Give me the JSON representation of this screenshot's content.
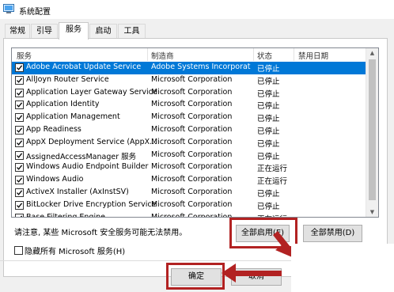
{
  "window": {
    "title": "系统配置"
  },
  "tabs": [
    {
      "label": "常规",
      "active": false
    },
    {
      "label": "引导",
      "active": false
    },
    {
      "label": "服务",
      "active": true
    },
    {
      "label": "启动",
      "active": false
    },
    {
      "label": "工具",
      "active": false
    }
  ],
  "table": {
    "headers": {
      "service": "服务",
      "manufacturer": "制造商",
      "status": "状态",
      "disabled_date": "禁用日期"
    },
    "rows": [
      {
        "name": "Adobe Acrobat Update Service",
        "manufacturer": "Adobe Systems Incorporat",
        "status": "已停止",
        "checked": true,
        "selected": true
      },
      {
        "name": "AllJoyn Router Service",
        "manufacturer": "Microsoft Corporation",
        "status": "已停止",
        "checked": true
      },
      {
        "name": "Application Layer Gateway Service",
        "manufacturer": "Microsoft Corporation",
        "status": "已停止",
        "checked": true
      },
      {
        "name": "Application Identity",
        "manufacturer": "Microsoft Corporation",
        "status": "已停止",
        "checked": true
      },
      {
        "name": "Application Management",
        "manufacturer": "Microsoft Corporation",
        "status": "已停止",
        "checked": true
      },
      {
        "name": "App Readiness",
        "manufacturer": "Microsoft Corporation",
        "status": "已停止",
        "checked": true
      },
      {
        "name": "AppX Deployment Service (AppX...",
        "manufacturer": "Microsoft Corporation",
        "status": "已停止",
        "checked": true
      },
      {
        "name": "AssignedAccessManager 服务",
        "manufacturer": "Microsoft Corporation",
        "status": "已停止",
        "checked": true
      },
      {
        "name": "Windows Audio Endpoint Builder",
        "manufacturer": "Microsoft Corporation",
        "status": "正在运行",
        "checked": true
      },
      {
        "name": "Windows Audio",
        "manufacturer": "Microsoft Corporation",
        "status": "正在运行",
        "checked": true
      },
      {
        "name": "ActiveX Installer (AxInstSV)",
        "manufacturer": "Microsoft Corporation",
        "status": "已停止",
        "checked": true
      },
      {
        "name": "BitLocker Drive Encryption Service",
        "manufacturer": "Microsoft Corporation",
        "status": "已停止",
        "checked": true
      },
      {
        "name": "Base Filtering Engine",
        "manufacturer": "Microsoft Corporation",
        "status": "正在运行",
        "checked": true
      }
    ]
  },
  "note": "请注意, 某些 Microsoft 安全服务可能无法禁用。",
  "buttons": {
    "enable_all": "全部启用(E)",
    "disable_all": "全部禁用(D)",
    "ok": "确定",
    "cancel": "取消"
  },
  "hide_ms": {
    "label": "隐藏所有 Microsoft 服务(H)",
    "checked": false
  },
  "colors": {
    "selection": "#0078d7",
    "highlight_box": "#b22222"
  },
  "icons": {
    "window_icon": "system-config-icon",
    "scroll_up": "scroll-up-icon",
    "scroll_down": "scroll-down-icon",
    "check": "checkmark-icon",
    "arrow": "arrow-annotation-icon"
  }
}
